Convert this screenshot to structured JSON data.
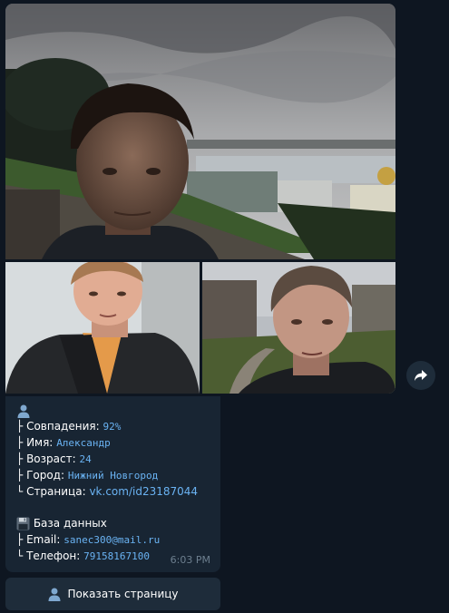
{
  "message": {
    "result": {
      "match_label": "Совпадения:",
      "match_value": "92%",
      "name_label": "Имя:",
      "name_value": "Александр",
      "age_label": "Возраст:",
      "age_value": "24",
      "city_label": "Город:",
      "city_value": "Нижний Новгород",
      "page_label": "Страница:",
      "page_value": "vk.com/id23187044"
    },
    "database": {
      "title": "База данных",
      "email_label": "Email:",
      "email_value": "sanec300@mail.ru",
      "phone_label": "Телефон:",
      "phone_value": "79158167100"
    },
    "time": "6:03 PM"
  },
  "tree_chars": {
    "branch": "├",
    "last": "└"
  },
  "button": {
    "label": "Показать страницу",
    "icon": "user-icon"
  },
  "share_icon": "share-arrow-icon",
  "colors": {
    "background": "#0e1621",
    "bubble": "#182533",
    "accent": "#6ab3f3",
    "time": "#6d7f8f"
  }
}
